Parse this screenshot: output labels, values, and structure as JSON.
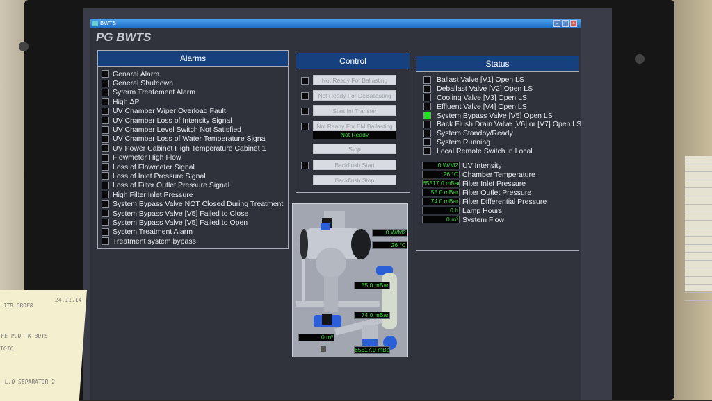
{
  "window": {
    "titlebar_text": "BWTS",
    "app_title": "PG BWTS",
    "controls": [
      "minimize",
      "maximize",
      "close"
    ]
  },
  "alarms": {
    "header": "Alarms",
    "items": [
      {
        "label": "Genaral Alarm",
        "active": false
      },
      {
        "label": "General Shutdown",
        "active": false
      },
      {
        "label": "Syterm Treatement Alarm",
        "active": false
      },
      {
        "label": "High ΔP",
        "active": false
      },
      {
        "label": "UV Chamber Wiper Overload Fault",
        "active": false
      },
      {
        "label": "UV Chamber Loss of Intensity Signal",
        "active": false
      },
      {
        "label": "UV Chamber Level Switch Not Satisfied",
        "active": false
      },
      {
        "label": "UV Chamber Loss of Water Temperature Signal",
        "active": false
      },
      {
        "label": "UV Power Cabinet High Temperature Cabinet 1",
        "active": false
      },
      {
        "label": "Flowmeter High Flow",
        "active": false
      },
      {
        "label": "Loss of Flowmeter Signal",
        "active": false
      },
      {
        "label": "Loss of Inlet Pressure Signal",
        "active": false
      },
      {
        "label": "Loss of Filter Outlet Pressure Signal",
        "active": false
      },
      {
        "label": "High Filter Inlet Pressure",
        "active": false
      },
      {
        "label": "System Bypass Valve NOT Closed During Treatment",
        "active": false
      },
      {
        "label": "System Bypass Valve [V5] Failed to Close",
        "active": false
      },
      {
        "label": "System Bypass Valve [V5] Failed to Open",
        "active": false
      },
      {
        "label": "System Treatment Alarm",
        "active": false
      },
      {
        "label": "Treatment system bypass",
        "active": false
      }
    ]
  },
  "control": {
    "header": "Control",
    "buttons": [
      {
        "label": "Not Ready For Ballasting",
        "has_indicator": true
      },
      {
        "label": "Not Ready For DeBallasting",
        "has_indicator": true
      },
      {
        "label": "Start Int Transfer",
        "has_indicator": true
      },
      {
        "label": "Not Ready For EM Ballasting",
        "has_indicator": true
      },
      {
        "label": "Stop",
        "has_indicator": false
      },
      {
        "label": "Backflush Start",
        "has_indicator": true
      },
      {
        "label": "Backflush Stop",
        "has_indicator": false
      }
    ],
    "ready_status": "Not Ready"
  },
  "status": {
    "header": "Status",
    "items": [
      {
        "label": "Ballast Valve [V1] Open LS",
        "active": false
      },
      {
        "label": "Deballast Valve [V2] Open LS",
        "active": false
      },
      {
        "label": "Cooling Valve [V3] Open LS",
        "active": false
      },
      {
        "label": "Effluent Valve [V4] Open LS",
        "active": false
      },
      {
        "label": "System Bypass Valve [V5] Open LS",
        "active": true
      },
      {
        "label": "Back Flush Drain Valve [V6] or [V7] Open LS",
        "active": false
      },
      {
        "label": "System Standby/Ready",
        "active": false
      },
      {
        "label": "System Running",
        "active": false
      },
      {
        "label": "Local Remote Switch in Local",
        "active": false
      }
    ],
    "measurements": [
      {
        "value": "0 W/M2",
        "label": "UV Intensity"
      },
      {
        "value": "26 °C",
        "label": "Chamber Temperature"
      },
      {
        "value": "65517.0 mBar",
        "label": "Filter Inlet Pressure"
      },
      {
        "value": "55.0 mBar",
        "label": "Filter Outlet Pressure"
      },
      {
        "value": "74.0 mBar",
        "label": "Filter Differential Pressure"
      },
      {
        "value": "0 h",
        "label": "Lamp Hours"
      },
      {
        "value": "0 m³",
        "label": "System Flow"
      }
    ]
  },
  "diagram": {
    "readouts": {
      "uv_intensity": "0 W/M2",
      "chamber_temp": "26 °C",
      "outlet_pressure": "55.0 mBar",
      "diff_pressure": "74.0 mBar",
      "flow": "0 m³",
      "inlet_pressure": "65517.0 mBar"
    }
  },
  "colors": {
    "header_blue": "#17407e",
    "active_green": "#22e022",
    "readout_green": "#3cdc3c"
  },
  "desk_note": {
    "date": "24.11.14",
    "lines": [
      "JTB ORDER",
      "FE P.O TK BOTS",
      "TOIC.",
      "L.O SEPARATOR 2"
    ]
  }
}
